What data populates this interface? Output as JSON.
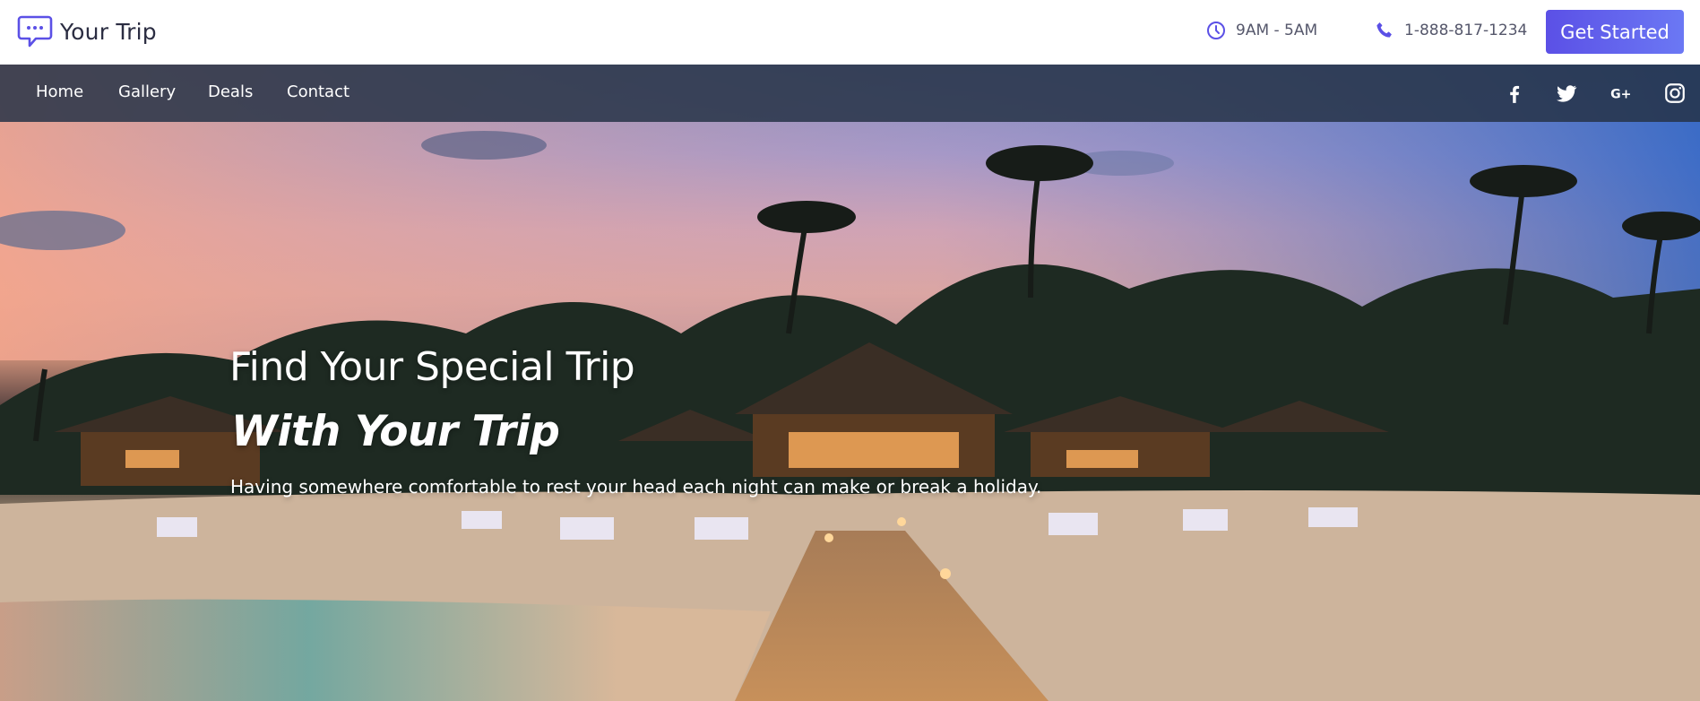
{
  "header": {
    "brand": "Your Trip",
    "hours": "9AM - 5AM",
    "phone": "1-888-817-1234",
    "cta_label": "Get Started"
  },
  "nav": {
    "items": [
      "Home",
      "Gallery",
      "Deals",
      "Contact"
    ],
    "social": [
      "facebook-icon",
      "twitter-icon",
      "google-plus-icon",
      "instagram-icon"
    ]
  },
  "hero": {
    "title_line1": "Find Your Special Trip",
    "title_line2": "With Your Trip",
    "subtitle": "Having somewhere comfortable to rest your head each night can make or break a holiday."
  },
  "colors": {
    "accent": "#5b50e6",
    "accent_end": "#6b78f4",
    "nav_bg": "#263246",
    "text_dark": "#2b2d42"
  }
}
